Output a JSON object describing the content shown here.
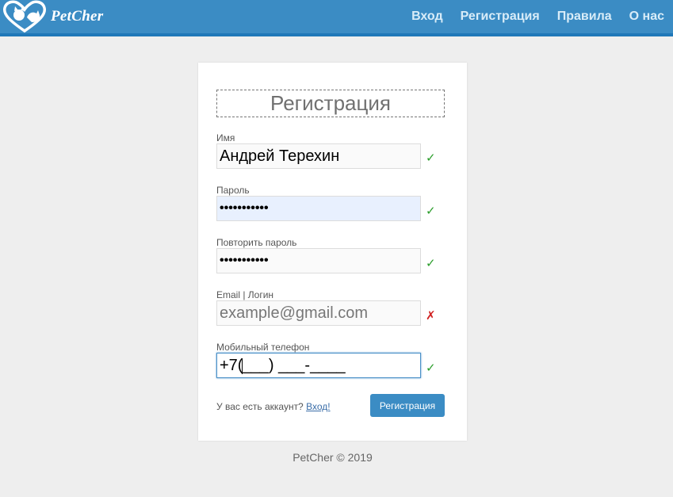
{
  "header": {
    "logo_text": "PetCher",
    "logo_icon": "heart-pets-icon",
    "nav": [
      {
        "label": "Вход"
      },
      {
        "label": "Регистрация"
      },
      {
        "label": "Правила"
      },
      {
        "label": "О нас"
      }
    ]
  },
  "form": {
    "title": "Регистрация",
    "fields": [
      {
        "label": "Имя",
        "value": "Андрей Терехин",
        "status": "ok",
        "status_glyph": "✓"
      },
      {
        "label": "Пароль",
        "value": "•••••••••••",
        "status": "ok",
        "status_glyph": "✓"
      },
      {
        "label": "Повторить пароль",
        "value": "•••••••••••",
        "status": "ok",
        "status_glyph": "✓"
      },
      {
        "label": "Email | Логин",
        "placeholder": "example@gmail.com",
        "status": "error",
        "status_glyph": "✗"
      },
      {
        "label": "Мобильный телефон",
        "value_prefix": "+7(",
        "value_suffix": "___) ___-____",
        "status": "ok",
        "status_glyph": "✓"
      }
    ],
    "account_question": "У вас есть аккаунт?",
    "login_link": "Вход!",
    "submit_label": "Регистрация"
  },
  "footer": {
    "text": "PetCher © 2019"
  },
  "colors": {
    "navbar": "#3b8cc4",
    "accent": "#3b8cc4",
    "ok": "#2a9d2a",
    "error": "#d02020",
    "autofill": "#e8f0fe"
  }
}
